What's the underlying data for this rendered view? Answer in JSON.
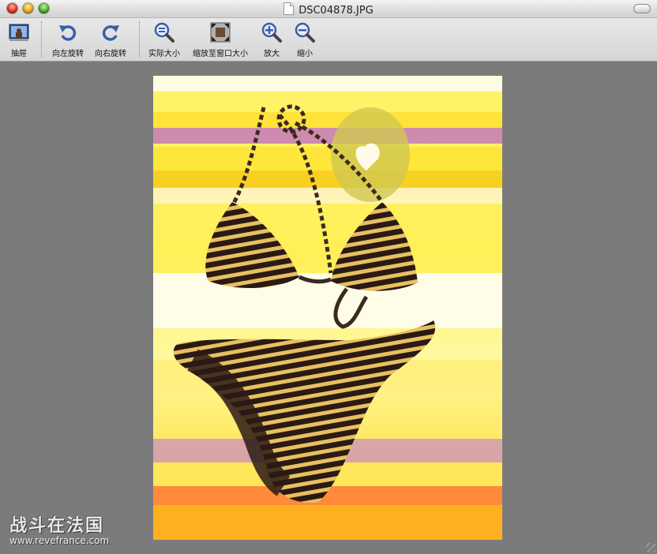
{
  "window": {
    "title": "DSC04878.JPG"
  },
  "toolbar": {
    "items": [
      {
        "label": "抽屉",
        "icon": "drawer-icon"
      },
      {
        "label": "向左旋转",
        "icon": "rotate-left-icon"
      },
      {
        "label": "向右旋转",
        "icon": "rotate-right-icon"
      },
      {
        "label": "实际大小",
        "icon": "actual-size-icon"
      },
      {
        "label": "缩放至窗口大小",
        "icon": "zoom-to-fit-icon"
      },
      {
        "label": "放大",
        "icon": "zoom-in-icon"
      },
      {
        "label": "缩小",
        "icon": "zoom-out-icon"
      }
    ]
  },
  "watermark": {
    "line1": "战斗在法国",
    "line2": "www.revefrance.com"
  },
  "colors": {
    "viewer_bg": "#7b7b7b",
    "toolbar_bg": "#dcdcdc",
    "accent_blue": "#3a5ea8"
  }
}
